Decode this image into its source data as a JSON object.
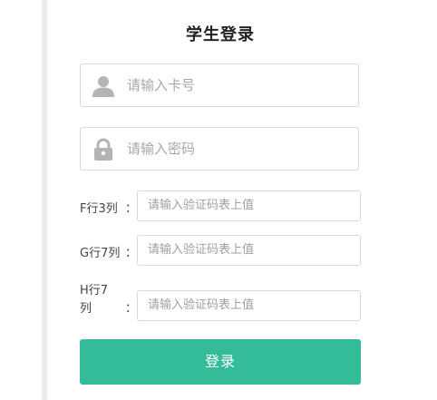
{
  "form": {
    "title": "学生登录",
    "card_field": {
      "placeholder": "请输入卡号",
      "icon": "user-icon"
    },
    "password_field": {
      "placeholder": "请输入密码",
      "icon": "lock-icon"
    },
    "captcha_rows": [
      {
        "label": "F行3列",
        "colon": "：",
        "placeholder": "请输入验证码表上值"
      },
      {
        "label": "G行7列",
        "colon": "：",
        "placeholder": "请输入验证码表上值"
      },
      {
        "label_line1": "H行7",
        "label_line2": "列",
        "colon": "：",
        "placeholder": "请输入验证码表上值"
      }
    ],
    "login_label": "登录"
  },
  "colors": {
    "accent": "#33bb9a",
    "border": "#d9d9d9",
    "placeholder": "#a8a8a8",
    "icon": "#b4b4b4"
  }
}
